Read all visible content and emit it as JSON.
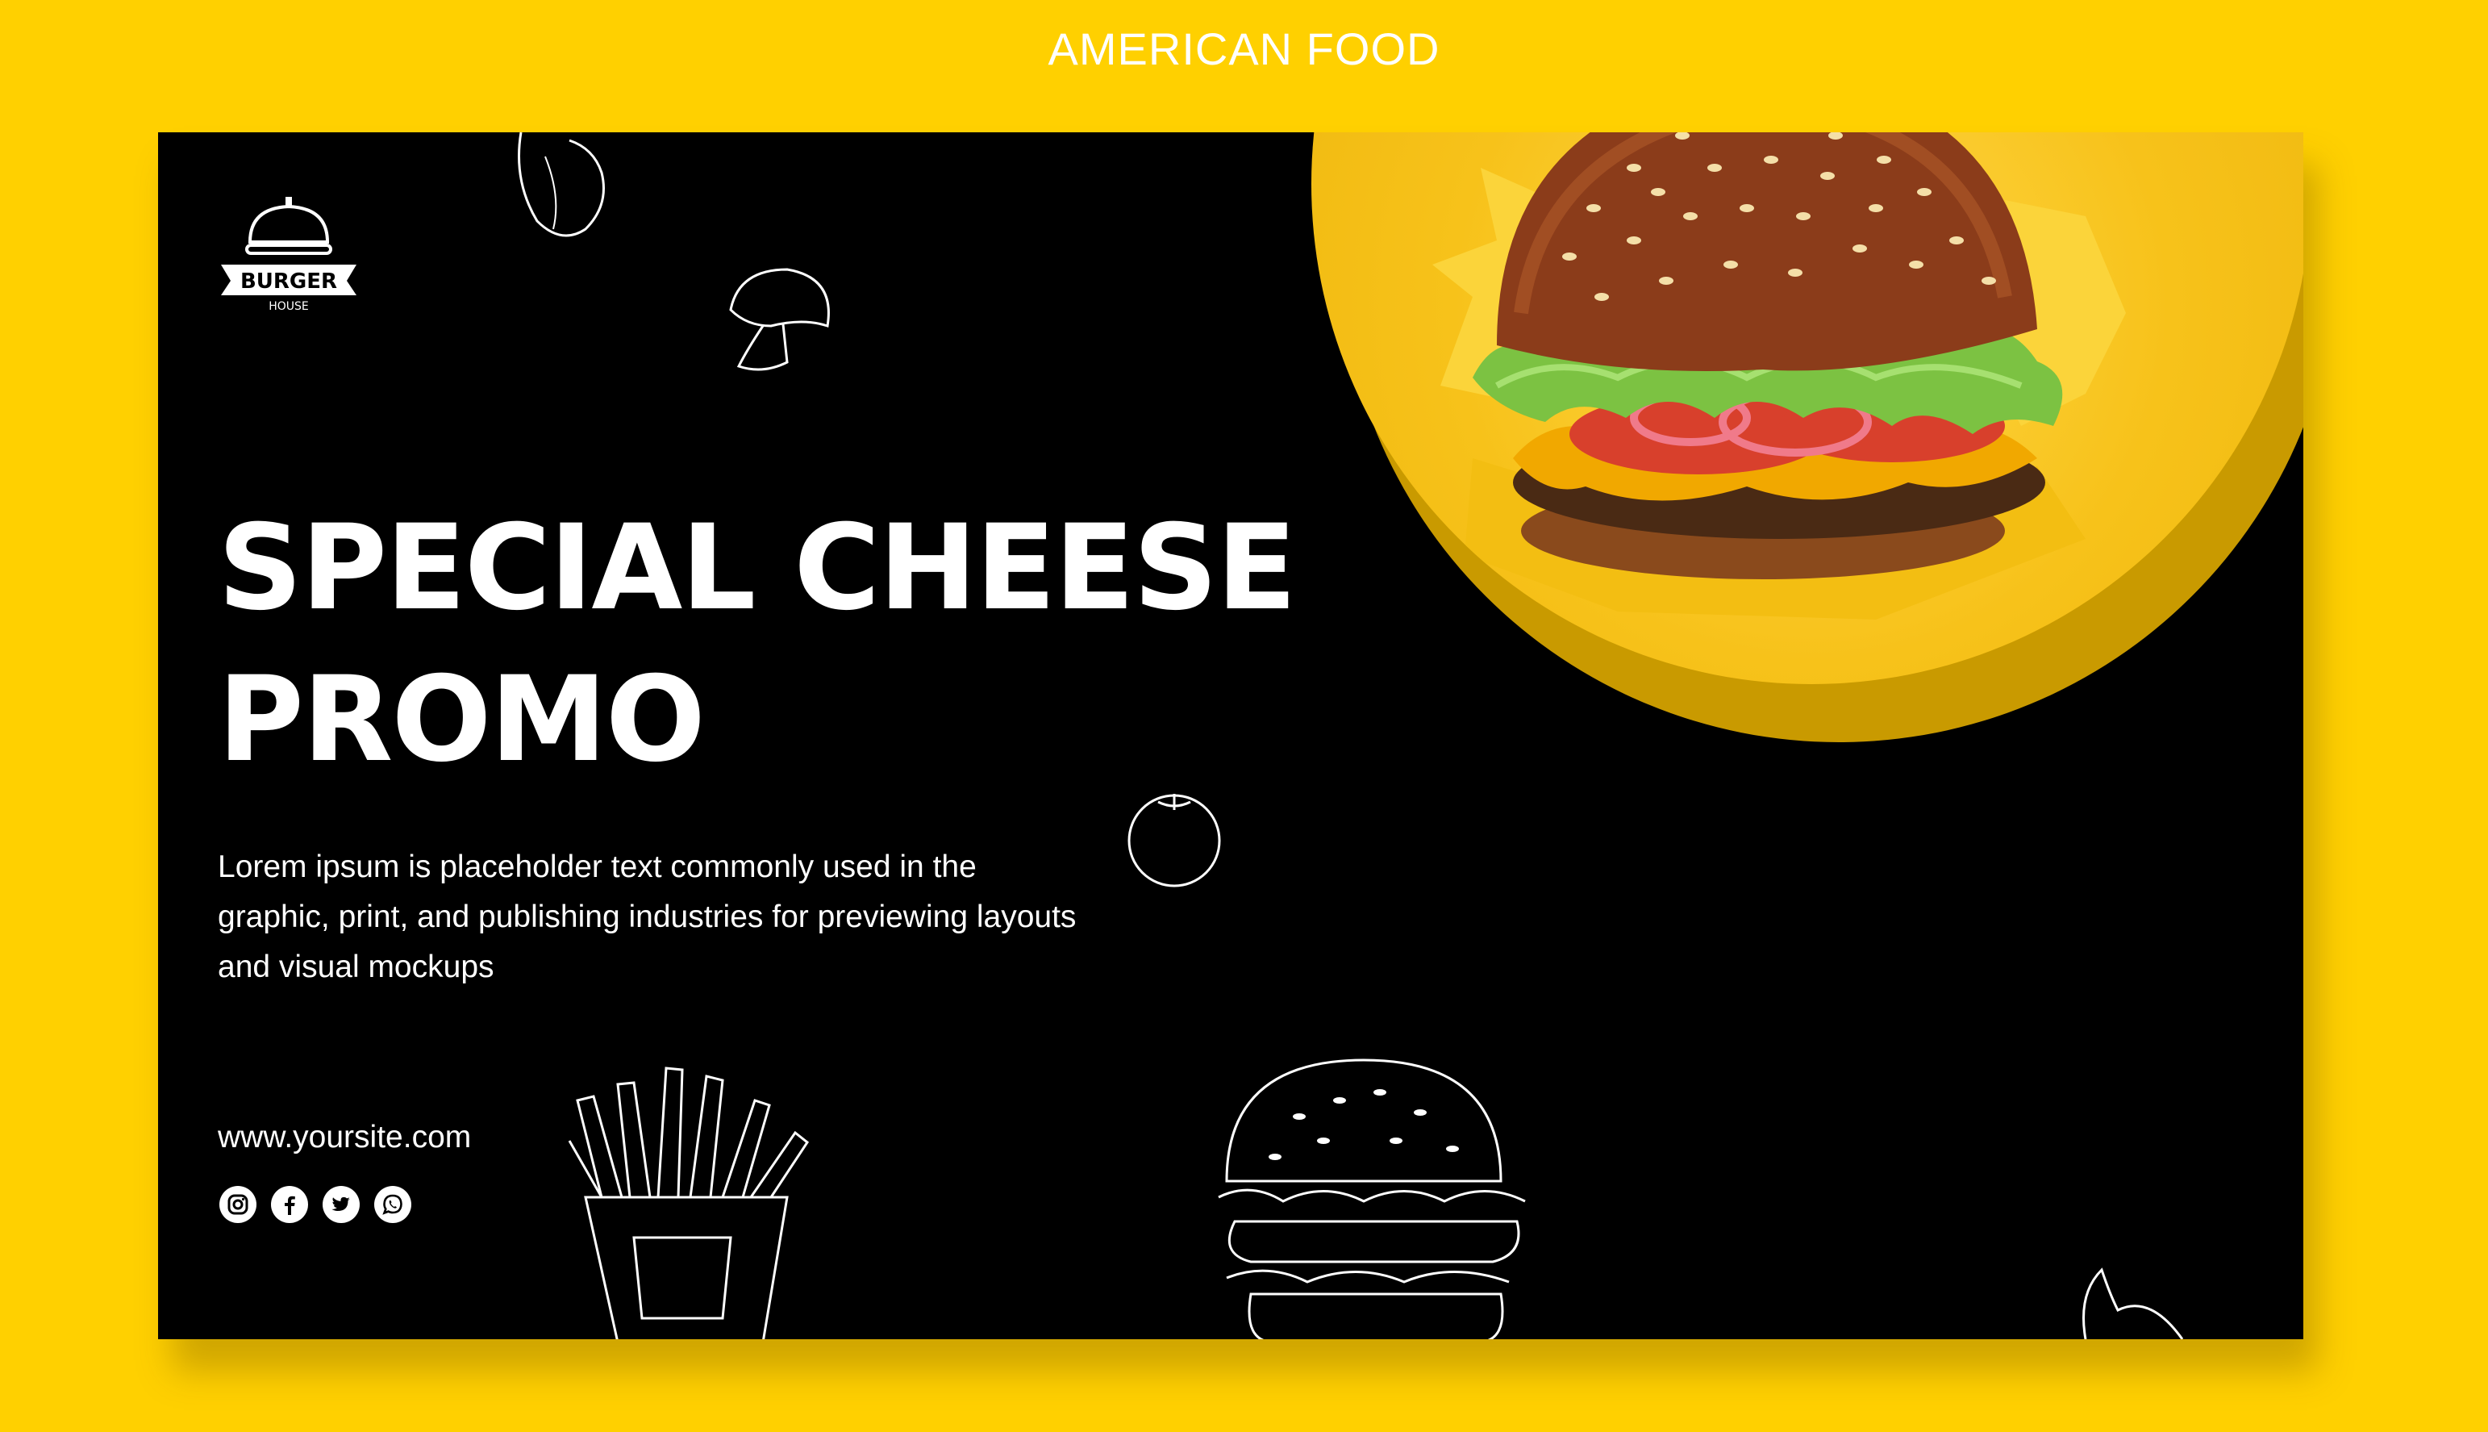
{
  "page": {
    "title": "AMERICAN FOOD"
  },
  "brand": {
    "logo_text": "BURGER",
    "logo_subtext": "HOUSE"
  },
  "promo": {
    "headline_line1": "SPECIAL CHEESE",
    "headline_line2": "PROMO",
    "description": "Lorem ipsum is placeholder text commonly used in the graphic, print, and publishing industries for previewing layouts and visual mockups",
    "website": "www.yoursite.com"
  },
  "socials": [
    {
      "icon": "instagram-icon"
    },
    {
      "icon": "facebook-icon"
    },
    {
      "icon": "twitter-icon"
    },
    {
      "icon": "whatsapp-icon"
    }
  ],
  "colors": {
    "background": "#ffd000",
    "banner": "#000000",
    "accent": "#f7c21a",
    "text": "#ffffff"
  }
}
